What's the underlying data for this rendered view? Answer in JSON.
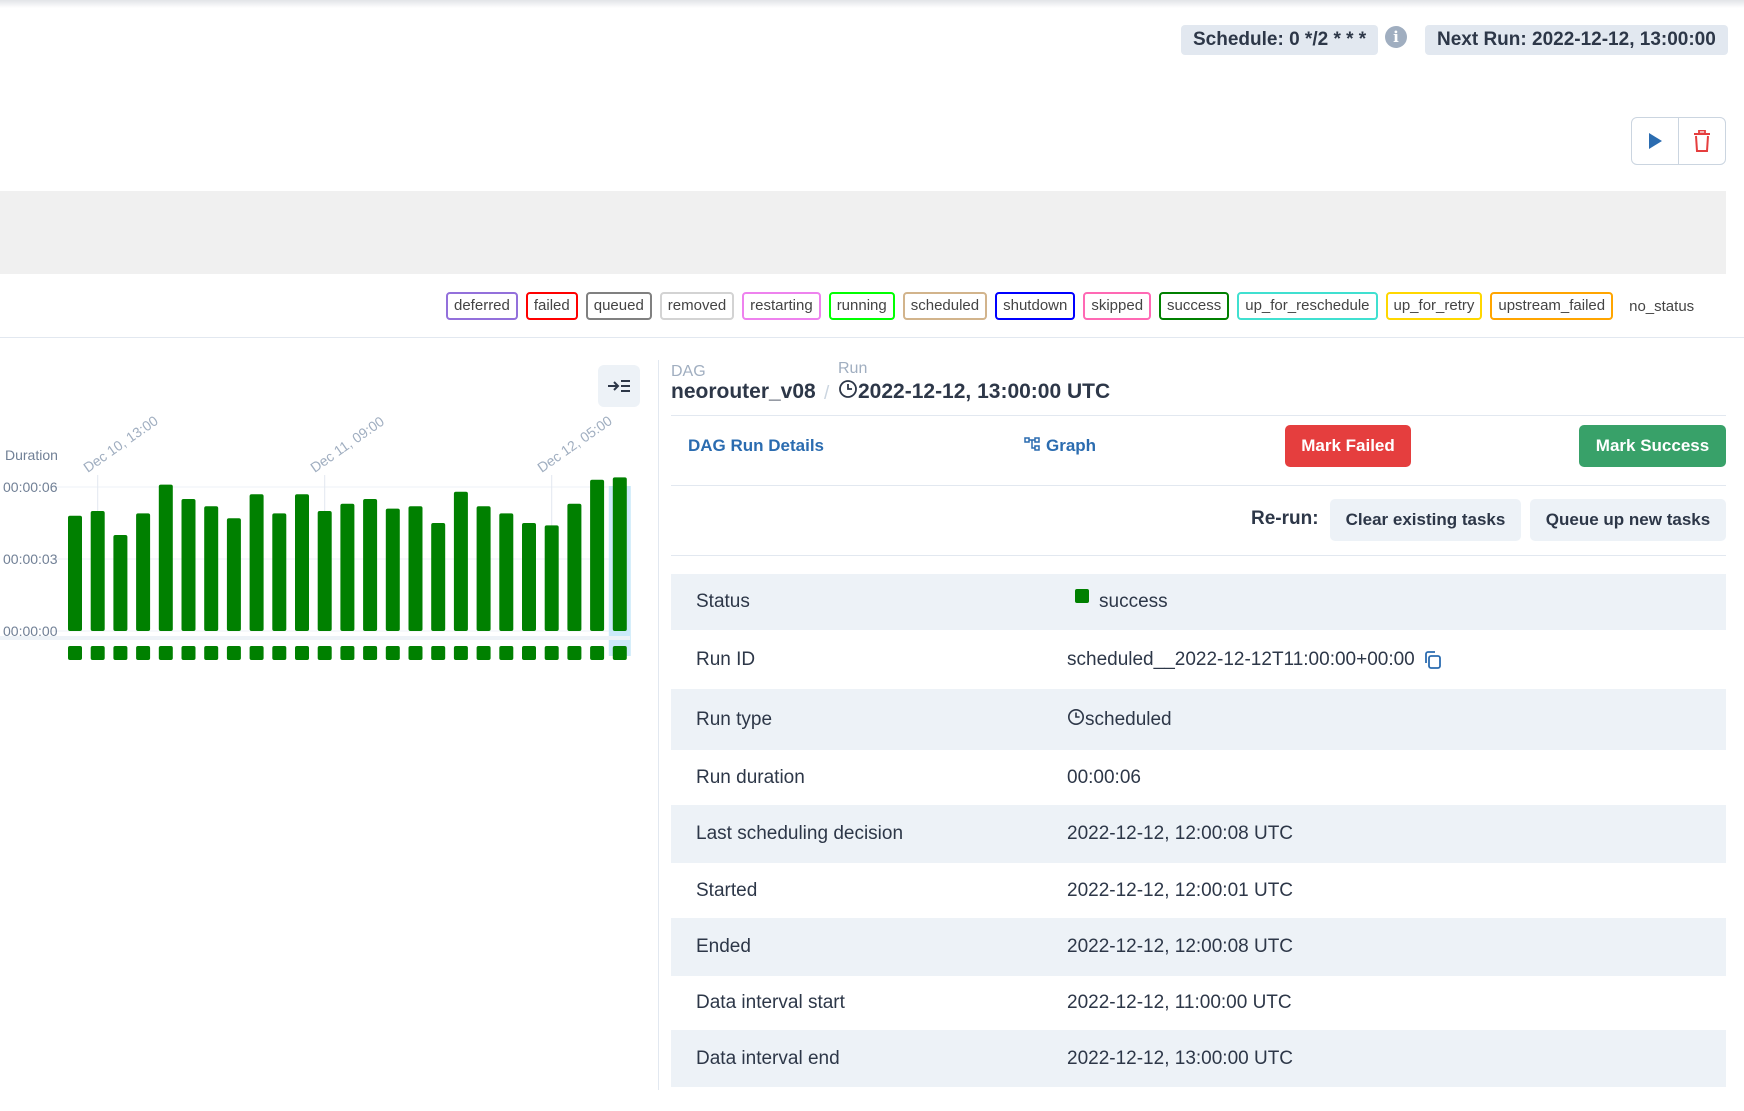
{
  "header": {
    "schedule": "Schedule: 0 */2 * * *",
    "info_glyph": "i",
    "next_run": "Next Run: 2022-12-12, 13:00:00"
  },
  "actions": {
    "trigger_icon": "play-icon",
    "delete_icon": "trash-icon"
  },
  "legend": [
    {
      "label": "deferred",
      "color": "#9370db"
    },
    {
      "label": "failed",
      "color": "#ff0000"
    },
    {
      "label": "queued",
      "color": "#808080"
    },
    {
      "label": "removed",
      "color": "#d3d3d3"
    },
    {
      "label": "restarting",
      "color": "#ee82ee"
    },
    {
      "label": "running",
      "color": "#00ff00"
    },
    {
      "label": "scheduled",
      "color": "#d2b48c"
    },
    {
      "label": "shutdown",
      "color": "#0000ff"
    },
    {
      "label": "skipped",
      "color": "#ff69b4"
    },
    {
      "label": "success",
      "color": "#008000"
    },
    {
      "label": "up_for_reschedule",
      "color": "#40e0d0"
    },
    {
      "label": "up_for_retry",
      "color": "#ffd700"
    },
    {
      "label": "upstream_failed",
      "color": "#ffa500"
    },
    {
      "label": "no_status",
      "color": ""
    }
  ],
  "chart_data": {
    "type": "bar",
    "ylabel": "Duration",
    "y_ticks": [
      "00:00:06",
      "00:00:03",
      "00:00:00"
    ],
    "x_ticks": [
      "Dec 10, 13:00",
      "Dec 11, 09:00",
      "Dec 12, 05:00"
    ],
    "ylim": [
      0,
      6
    ],
    "values": [
      4.8,
      5.0,
      4.0,
      4.9,
      6.1,
      5.5,
      5.2,
      4.7,
      5.7,
      4.9,
      5.7,
      5.0,
      5.3,
      5.5,
      5.1,
      5.2,
      4.5,
      5.8,
      5.2,
      4.9,
      4.5,
      4.4,
      5.3,
      6.3,
      6.4
    ],
    "status_color": "#008000",
    "selected_index": 24
  },
  "breadcrumb": {
    "dag_label": "DAG",
    "dag_id": "neorouter_v08",
    "separator": "/",
    "run_label": "Run",
    "run_value": "2022-12-12, 13:00:00 UTC"
  },
  "tabs": {
    "details": "DAG Run Details",
    "graph": "Graph"
  },
  "buttons": {
    "mark_failed": "Mark Failed",
    "mark_success": "Mark Success",
    "rerun_label": "Re-run:",
    "clear_existing": "Clear existing tasks",
    "queue_new": "Queue up new tasks"
  },
  "details": {
    "status": {
      "key": "Status",
      "value": "success"
    },
    "run_id": {
      "key": "Run ID",
      "value": "scheduled__2022-12-12T11:00:00+00:00"
    },
    "run_type": {
      "key": "Run type",
      "value": "scheduled"
    },
    "run_duration": {
      "key": "Run duration",
      "value": "00:00:06"
    },
    "last_sched": {
      "key": "Last scheduling decision",
      "value": "2022-12-12, 12:00:08 UTC"
    },
    "started": {
      "key": "Started",
      "value": "2022-12-12, 12:00:01 UTC"
    },
    "ended": {
      "key": "Ended",
      "value": "2022-12-12, 12:00:08 UTC"
    },
    "di_start": {
      "key": "Data interval start",
      "value": "2022-12-12, 11:00:00 UTC"
    },
    "di_end": {
      "key": "Data interval end",
      "value": "2022-12-12, 13:00:00 UTC"
    }
  }
}
